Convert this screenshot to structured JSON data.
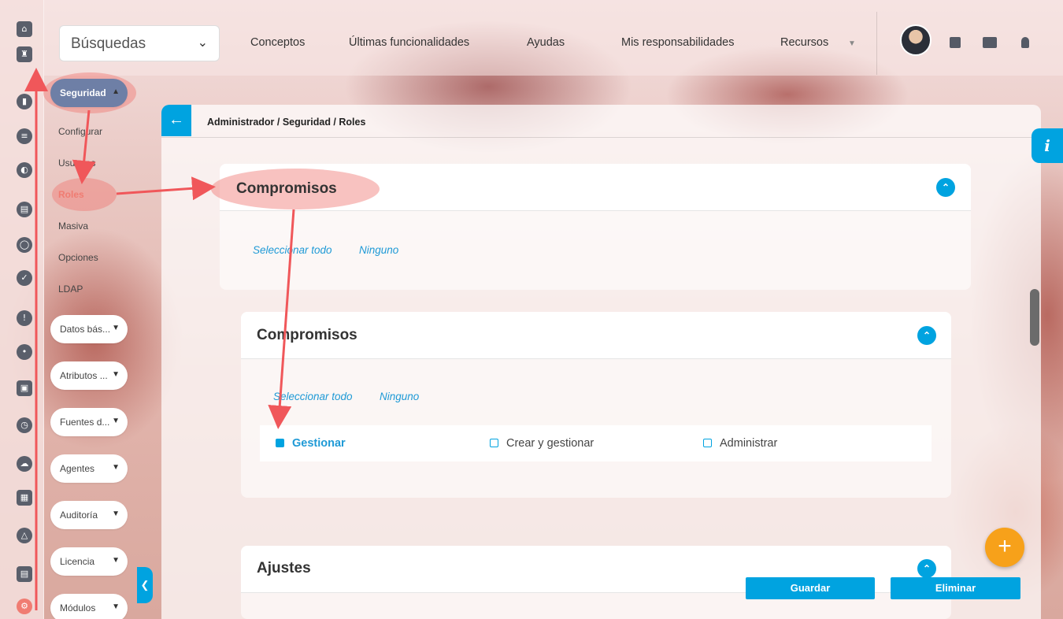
{
  "topbar": {
    "search_label": "Búsquedas",
    "nav": [
      "Conceptos",
      "Últimas funcionalidades",
      "Ayudas",
      "Mis responsabilidades",
      "Recursos"
    ]
  },
  "rail": {
    "icons": [
      "home-icon",
      "tower-icon",
      "bar-chart-icon",
      "list-icon",
      "pie-chart-icon",
      "document-icon",
      "circle-loading-icon",
      "check-circle-icon",
      "warning-icon",
      "dots-icon",
      "presentation-icon",
      "clock-icon",
      "cloud-icon",
      "calendar-icon",
      "network-icon",
      "file-icon",
      "gear-icon"
    ]
  },
  "sidebar": {
    "open_section": "Seguridad",
    "sub_items": [
      "Configurar",
      "Usuarios",
      "Roles",
      "Masiva",
      "Opciones",
      "LDAP"
    ],
    "sections": [
      "Datos bás...",
      "Atributos ...",
      "Fuentes d...",
      "Agentes",
      "Auditoría",
      "Licencia",
      "Módulos"
    ]
  },
  "panel": {
    "breadcrumb": "Administrador / Seguridad / Roles",
    "outer_title": "Compromisos",
    "select_all": "Seleccionar todo",
    "none": "Ninguno",
    "inner_title": "Compromisos",
    "permissions": [
      {
        "label": "Gestionar",
        "checked": true
      },
      {
        "label": "Crear y gestionar",
        "checked": false
      },
      {
        "label": "Administrar",
        "checked": false
      }
    ],
    "settings_title": "Ajustes"
  },
  "actions": {
    "save": "Guardar",
    "delete": "Eliminar"
  },
  "colors": {
    "accent": "#00a3e0",
    "highlight": "#f07c72",
    "fab": "#f7a11a"
  }
}
